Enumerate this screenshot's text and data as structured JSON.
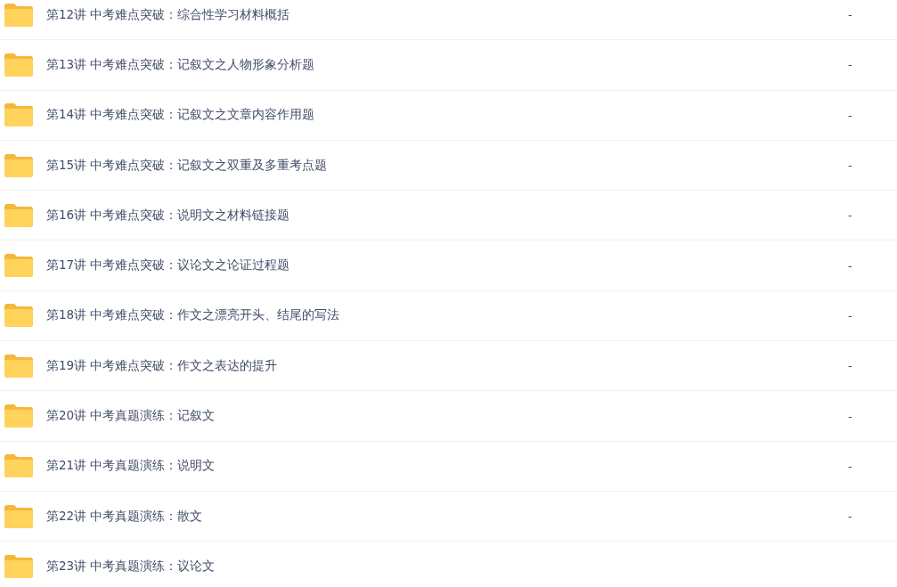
{
  "files": [
    {
      "name": "第12讲 中考难点突破：综合性学习材料概括",
      "size": "-"
    },
    {
      "name": "第13讲 中考难点突破：记叙文之人物形象分析题",
      "size": "-"
    },
    {
      "name": "第14讲 中考难点突破：记叙文之文章内容作用题",
      "size": "-"
    },
    {
      "name": "第15讲 中考难点突破：记叙文之双重及多重考点题",
      "size": "-"
    },
    {
      "name": "第16讲 中考难点突破：说明文之材料链接题",
      "size": "-"
    },
    {
      "name": "第17讲 中考难点突破：议论文之论证过程题",
      "size": "-"
    },
    {
      "name": "第18讲 中考难点突破：作文之漂亮开头、结尾的写法",
      "size": "-"
    },
    {
      "name": "第19讲 中考难点突破：作文之表达的提升",
      "size": "-"
    },
    {
      "name": "第20讲 中考真题演练：记叙文",
      "size": "-"
    },
    {
      "name": "第21讲 中考真题演练：说明文",
      "size": "-"
    },
    {
      "name": "第22讲 中考真题演练：散文",
      "size": "-"
    },
    {
      "name": "第23讲 中考真题演练：议论文"
    }
  ]
}
